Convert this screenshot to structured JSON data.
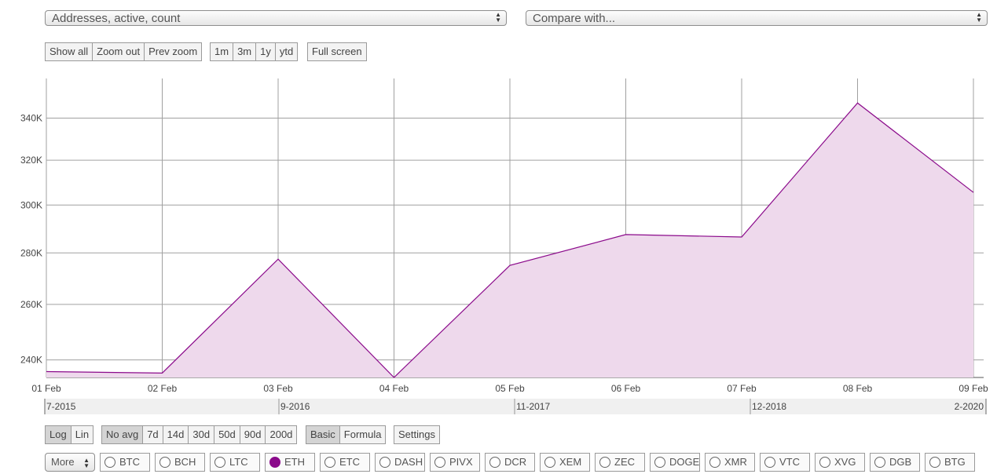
{
  "metric_select": {
    "value": "Addresses, active, count"
  },
  "compare_select": {
    "value": "Compare with..."
  },
  "zoom_buttons": [
    "Show all",
    "Zoom out",
    "Prev zoom"
  ],
  "range_buttons": [
    "1m",
    "3m",
    "1y",
    "ytd"
  ],
  "fullscreen_label": "Full screen",
  "scale_buttons": [
    "Log",
    "Lin"
  ],
  "avg_buttons": [
    "No avg",
    "7d",
    "14d",
    "30d",
    "50d",
    "90d",
    "200d"
  ],
  "mode_buttons": [
    "Basic",
    "Formula"
  ],
  "settings_label": "Settings",
  "more_select": {
    "value": "More"
  },
  "coins": [
    "BTC",
    "BCH",
    "LTC",
    "ETH",
    "ETC",
    "DASH",
    "PIVX",
    "DCR",
    "XEM",
    "ZEC",
    "DOGE",
    "XMR",
    "VTC",
    "XVG",
    "DGB",
    "BTG"
  ],
  "selected_coin": "ETH",
  "colors": {
    "line": "#8b0a8b",
    "fill": "#eed9ec",
    "grid": "#a0a0a0",
    "active_button": "#d4d4d4"
  },
  "navigator": {
    "labels": [
      "7-2015",
      "9-2016",
      "11-2017",
      "12-2018",
      "2-2020"
    ]
  },
  "chart_data": {
    "type": "area",
    "x": [
      "01 Feb",
      "02 Feb",
      "03 Feb",
      "04 Feb",
      "05 Feb",
      "06 Feb",
      "07 Feb",
      "08 Feb",
      "09 Feb"
    ],
    "values": [
      236000,
      235500,
      277500,
      234000,
      275000,
      287500,
      286500,
      347500,
      305500
    ],
    "yticks": [
      240000,
      260000,
      280000,
      300000,
      320000,
      340000
    ],
    "ytick_labels": [
      "240K",
      "260K",
      "280K",
      "300K",
      "320K",
      "340K"
    ],
    "yscale": "log",
    "ylim": [
      234000,
      360000
    ],
    "grid": true,
    "title": "",
    "xlabel": "",
    "ylabel": ""
  }
}
